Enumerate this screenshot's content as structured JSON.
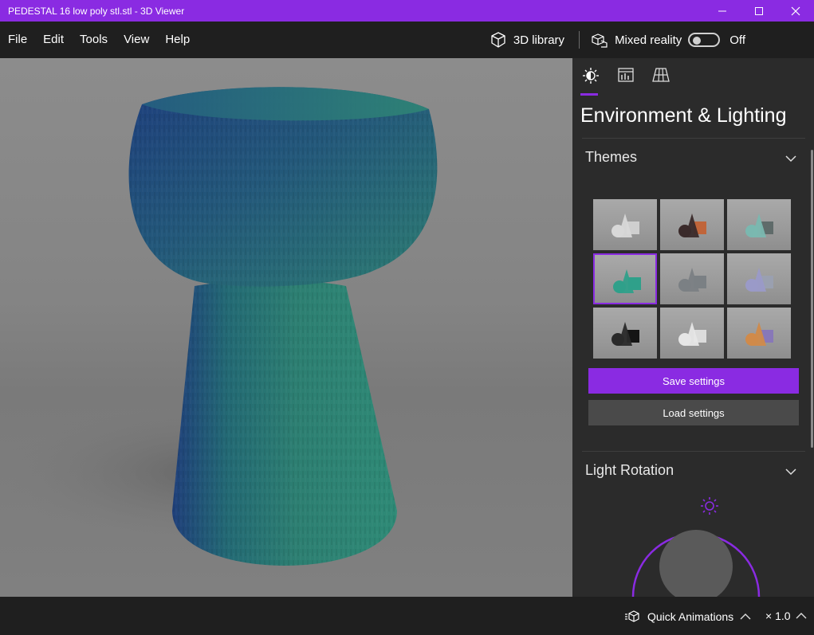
{
  "window": {
    "title": "PEDESTAL 16 low poly stl.stl - 3D Viewer",
    "accent": "#8a2be2"
  },
  "menu": {
    "items": [
      "File",
      "Edit",
      "Tools",
      "View",
      "Help"
    ]
  },
  "toolbar": {
    "library_label": "3D library",
    "mixed_reality_label": "Mixed reality",
    "mixed_reality_state": "Off"
  },
  "panel": {
    "tabs": [
      "environment-lighting",
      "stats-shading",
      "grid-views"
    ],
    "active_tab": "environment-lighting",
    "title": "Environment & Lighting",
    "themes": {
      "header": "Themes",
      "selected_index": 3,
      "items": [
        {
          "color_a": "#d8d8d8",
          "color_b": "#cfcfcf"
        },
        {
          "color_a": "#3a2a2a",
          "color_b": "#c0653a"
        },
        {
          "color_a": "#7ab8b0",
          "color_b": "#5f6b6a"
        },
        {
          "color_a": "#2fa08a",
          "color_b": "#2fa08a"
        },
        {
          "color_a": "#7b8084",
          "color_b": "#7b8084"
        },
        {
          "color_a": "#9a9ac8",
          "color_b": "#9aa0b0"
        },
        {
          "color_a": "#2a2a2a",
          "color_b": "#141414"
        },
        {
          "color_a": "#e6e6e6",
          "color_b": "#dcdcdc"
        },
        {
          "color_a": "#d08a4a",
          "color_b": "#8878b8"
        }
      ],
      "save_label": "Save settings",
      "load_label": "Load settings"
    },
    "light_rotation": {
      "header": "Light Rotation"
    }
  },
  "status": {
    "quick_animations_label": "Quick Animations",
    "speed_label": "× 1.0"
  }
}
